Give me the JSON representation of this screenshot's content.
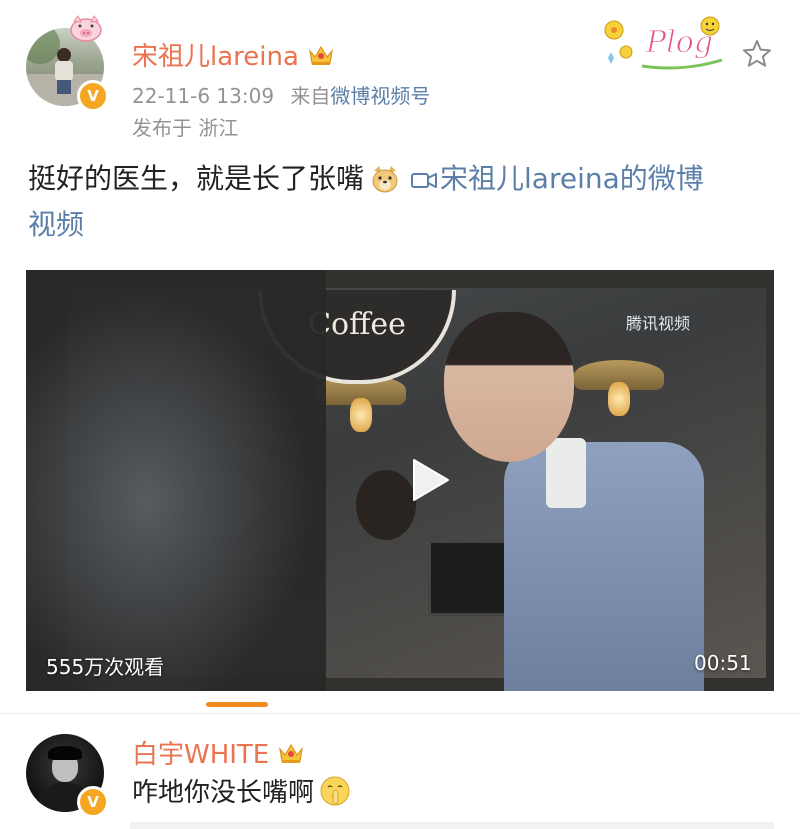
{
  "post": {
    "username": "宋祖儿lareina",
    "timestamp": "22-11-6 13:09",
    "source_prefix": "来自",
    "source": "微博视频号",
    "location": "发布于 浙江",
    "text": "挺好的医生，就是长了张嘴",
    "video_link_line1": "宋祖儿lareina的微博",
    "video_link_line2": "视频",
    "verified_icon": "verified-v-badge",
    "crown_icon": "crown-icon",
    "sticker": "Plog"
  },
  "video": {
    "views": "555万次观看",
    "duration": "00:51",
    "sign_text": "Coffee",
    "watermark": "腾讯视频"
  },
  "comment": {
    "username": "白宇WHITE",
    "text": "咋地你没长嘴啊",
    "emoji_icon": "shush-face-icon"
  },
  "colors": {
    "username": "#eb7350",
    "link": "#5b7fa8",
    "meta": "#939393",
    "verified": "#f5a623",
    "tab_indicator": "#f28a1e"
  }
}
